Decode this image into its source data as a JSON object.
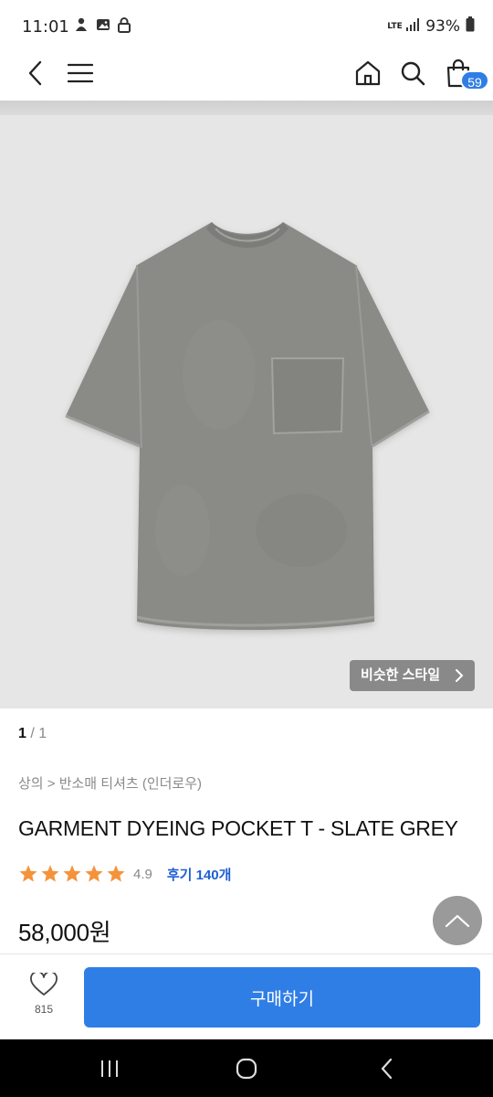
{
  "status_bar": {
    "time": "11:01",
    "network": "LTE",
    "battery": "93%"
  },
  "top_nav": {
    "cart_count": "59"
  },
  "gallery": {
    "similar_style_label": "비슷한 스타일",
    "current": "1",
    "separator": "/",
    "total": "1"
  },
  "product": {
    "breadcrumb": "상의 > 반소매 티셔츠 (인더로우)",
    "title": "GARMENT DYEING POCKET T - SLATE GREY",
    "rating": "4.9",
    "star_count": 5,
    "reviews_label": "후기 140개",
    "price": "58,000원"
  },
  "action_bar": {
    "like_count": "815",
    "buy_label": "구매하기"
  },
  "colors": {
    "accent": "#2f7ee6",
    "star": "#f5933b",
    "review_link": "#1f5fd0",
    "shirt": "#8a8a86"
  }
}
